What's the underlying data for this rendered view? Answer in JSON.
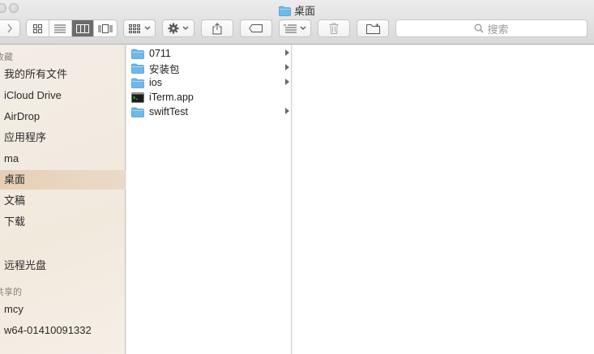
{
  "window": {
    "title": "桌面"
  },
  "toolbar": {
    "search_placeholder": "搜索"
  },
  "sidebar": {
    "favorites_header": "收藏",
    "favorites": [
      "我的所有文件",
      "iCloud Drive",
      "AirDrop",
      "应用程序",
      "ma",
      "桌面",
      "文稿",
      "下载"
    ],
    "selected": "桌面",
    "devices": [
      "远程光盘"
    ],
    "shared_header": "共享的",
    "shared": [
      "mcy",
      "w64-01410091332"
    ]
  },
  "files": [
    {
      "name": "0711",
      "kind": "folder"
    },
    {
      "name": "安装包",
      "kind": "folder"
    },
    {
      "name": "ios",
      "kind": "folder"
    },
    {
      "name": "iTerm.app",
      "kind": "app"
    },
    {
      "name": "swiftTest",
      "kind": "folder"
    }
  ],
  "colors": {
    "folder": "#6fb8ea",
    "selection": "#e6cfb4"
  }
}
